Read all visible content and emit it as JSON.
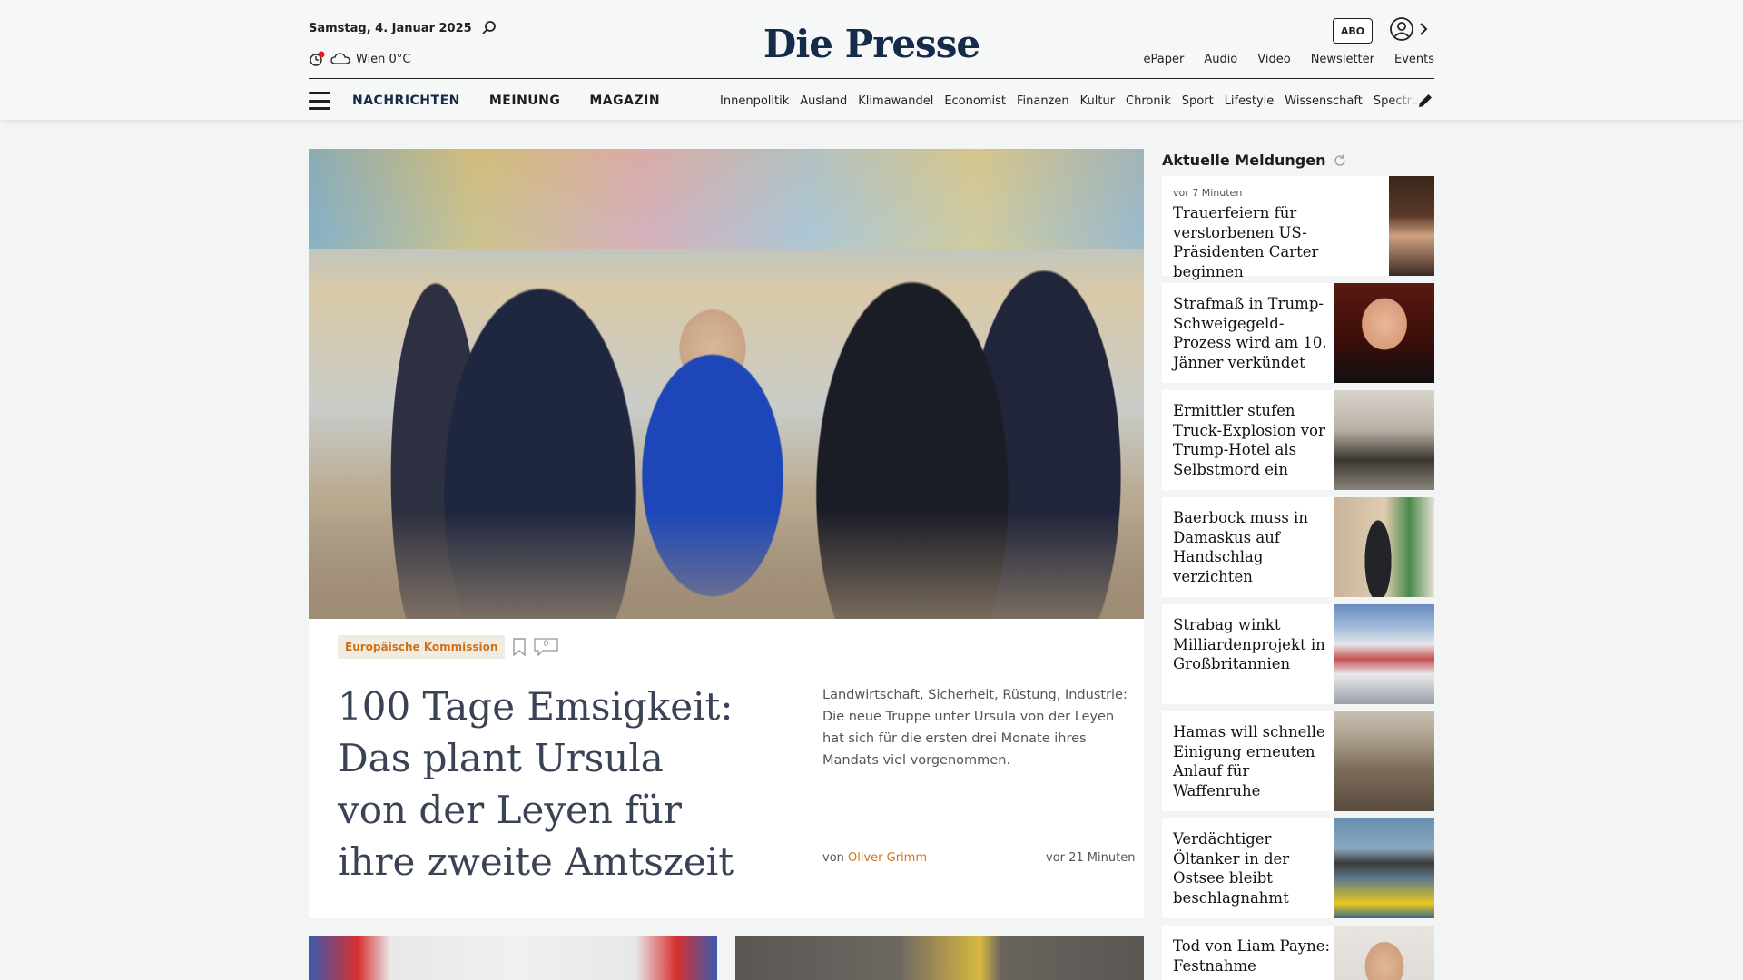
{
  "header": {
    "date": "Samstag, 4. Januar 2025",
    "weather": "Wien 0°C",
    "logo": "Die Presse",
    "abo_label": "ABO",
    "util_links": [
      "ePaper",
      "Audio",
      "Video",
      "Newsletter",
      "Events"
    ]
  },
  "nav": {
    "main": [
      "NACHRICHTEN",
      "MEINUNG",
      "MAGAZIN"
    ],
    "sub": [
      "Innenpolitik",
      "Ausland",
      "Klimawandel",
      "Economist",
      "Finanzen",
      "Kultur",
      "Chronik",
      "Sport",
      "Lifestyle",
      "Wissenschaft",
      "Spectrum"
    ]
  },
  "hero": {
    "tag": "Europäische Kommission",
    "comment_count": "0",
    "headline": "100 Tage Emsigkeit: Das plant Ursula von der Leyen für ihre zweite Amtszeit",
    "teaser": "Landwirtschaft, Sicherheit, Rüstung, Industrie: Die neue Truppe unter Ursula von der Leyen hat sich für die ersten drei Monate ihres Mandats viel vorgenommen.",
    "byline_prefix": "von",
    "author": "Oliver Grimm",
    "time": "vor 21 Minuten"
  },
  "sidebar": {
    "title": "Aktuelle Meldungen",
    "items": [
      {
        "time": "vor 7 Minuten",
        "title": "Trauerfeiern für verstorbenen US-Präsidenten Carter beginnen"
      },
      {
        "time": "",
        "title": "Strafmaß in Trump-Schweigegeld-Prozess wird am 10. Jänner verkündet"
      },
      {
        "time": "",
        "title": "Ermittler stufen Truck-Explosion vor Trump-Hotel als Selbstmord ein"
      },
      {
        "time": "",
        "title": "Baerbock muss in Damaskus auf Handschlag verzichten"
      },
      {
        "time": "",
        "title": "Strabag winkt Milliardenprojekt in Großbritannien"
      },
      {
        "time": "",
        "title": "Hamas will schnelle Einigung erneuten Anlauf für Waffenruhe"
      },
      {
        "time": "",
        "title": "Verdächtiger Öltanker in der Ostsee bleibt beschlagnahmt"
      },
      {
        "time": "",
        "title": "Tod von Liam Payne: Festnahme"
      }
    ]
  },
  "colors": {
    "logo": "#162b4a",
    "accent": "#d0721b",
    "headline": "#3a4256"
  }
}
